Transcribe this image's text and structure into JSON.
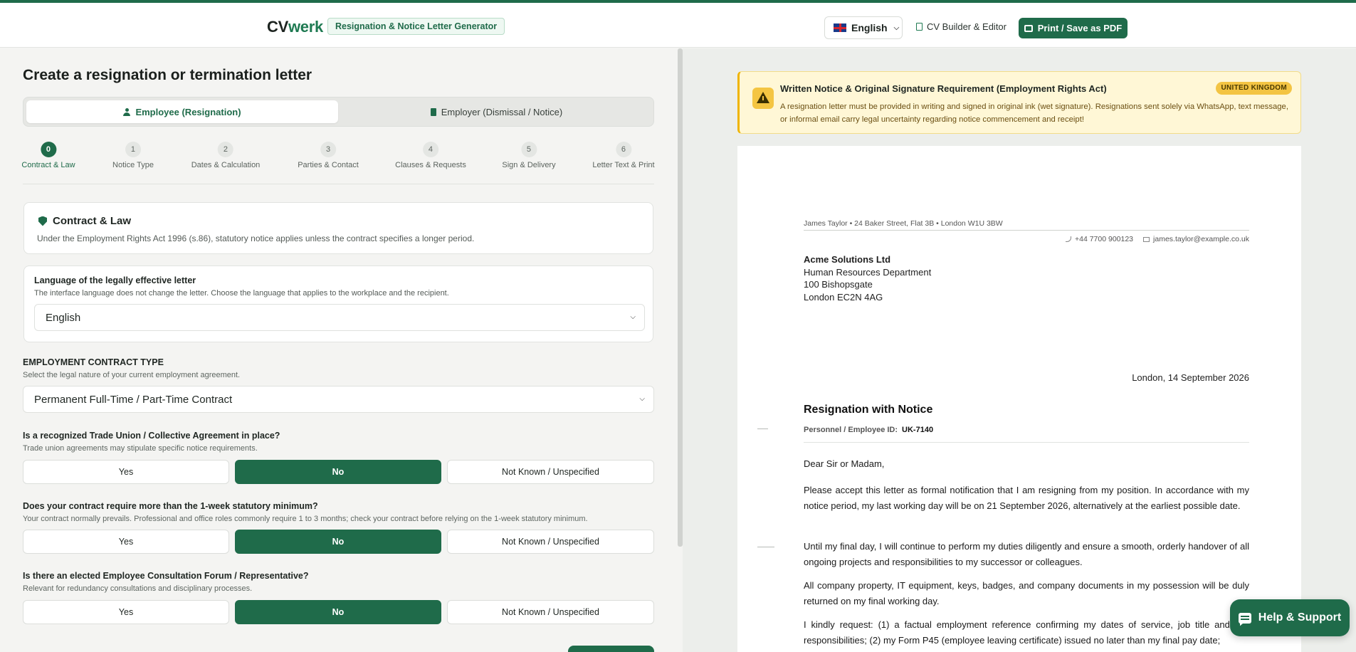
{
  "header": {
    "brand_main": "CV",
    "brand_accent": "werk",
    "tool_name": "Resignation & Notice Letter Generator",
    "language": "English",
    "cv_builder": "CV Builder & Editor",
    "print": "Print / Save as PDF"
  },
  "form": {
    "title": "Create a resignation or termination letter",
    "roles": {
      "employee": "Employee (Resignation)",
      "employer": "Employer (Dismissal / Notice)"
    },
    "steps": [
      {
        "num": "0",
        "label": "Contract & Law"
      },
      {
        "num": "1",
        "label": "Notice Type"
      },
      {
        "num": "2",
        "label": "Dates & Calculation"
      },
      {
        "num": "3",
        "label": "Parties & Contact"
      },
      {
        "num": "4",
        "label": "Clauses & Requests"
      },
      {
        "num": "5",
        "label": "Sign & Delivery"
      },
      {
        "num": "6",
        "label": "Letter Text & Print"
      }
    ],
    "law_card": {
      "title": "Contract & Law",
      "desc": "Under the Employment Rights Act 1996 (s.86), statutory notice applies unless the contract specifies a longer period."
    },
    "letter_language": {
      "label": "Language of the legally effective letter",
      "help": "The interface language does not change the letter. Choose the language that applies to the workplace and the recipient.",
      "value": "English"
    },
    "contract_type": {
      "label": "EMPLOYMENT CONTRACT TYPE",
      "help": "Select the legal nature of your current employment agreement.",
      "value": "Permanent Full-Time / Part-Time Contract"
    },
    "questions": [
      {
        "label": "Is a recognized Trade Union / Collective Agreement in place?",
        "help": "Trade union agreements may stipulate specific notice requirements.",
        "options": [
          "Yes",
          "No",
          "Not Known / Unspecified"
        ],
        "selected": "No"
      },
      {
        "label": "Does your contract require more than the 1-week statutory minimum?",
        "help": "Your contract normally prevails. Professional and office roles commonly require 1 to 3 months; check your contract before relying on the 1-week statutory minimum.",
        "options": [
          "Yes",
          "No",
          "Not Known / Unspecified"
        ],
        "selected": "No"
      },
      {
        "label": "Is there an elected Employee Consultation Forum / Representative?",
        "help": "Relevant for redundancy consultations and disciplinary processes.",
        "options": [
          "Yes",
          "No",
          "Not Known / Unspecified"
        ],
        "selected": "No"
      }
    ]
  },
  "preview": {
    "notice": {
      "title": "Written Notice & Original Signature Requirement (Employment Rights Act)",
      "badge": "UNITED KINGDOM",
      "text": "A resignation letter must be provided in writing and signed in original ink (wet signature). Resignations sent solely via WhatsApp, text message, or informal email carry legal uncertainty regarding notice commencement and receipt!"
    },
    "letter": {
      "sender": "James Taylor • 24 Baker Street, Flat 3B • London W1U 3BW",
      "phone": "+44 7700 900123",
      "email": "james.taylor@example.co.uk",
      "recipient": [
        "Acme Solutions Ltd",
        "Human Resources Department",
        "100 Bishopsgate",
        "London EC2N 4AG"
      ],
      "place_date": "London, 14 September 2026",
      "subject": "Resignation with Notice",
      "id_label": "Personnel / Employee ID:",
      "id_value": "UK-7140",
      "salutation": "Dear Sir or Madam,",
      "paragraphs": [
        "Please accept this letter as formal notification that I am resigning from my position. In accordance with my notice period, my last working day will be on 21 September 2026, alternatively at the earliest possible date.",
        "Until my final day, I will continue to perform my duties diligently and ensure a smooth, orderly handover of all ongoing projects and responsibilities to my successor or colleagues.",
        "All company property, IT equipment, keys, badges, and company documents in my possession will be duly returned on my final working day.",
        "I kindly request: (1) a factual employment reference confirming my dates of service, job title and key responsibilities; (2) my Form P45 (employee leaving certificate) issued no later than my final pay date;"
      ]
    }
  },
  "help": {
    "label": "Help & Support"
  }
}
